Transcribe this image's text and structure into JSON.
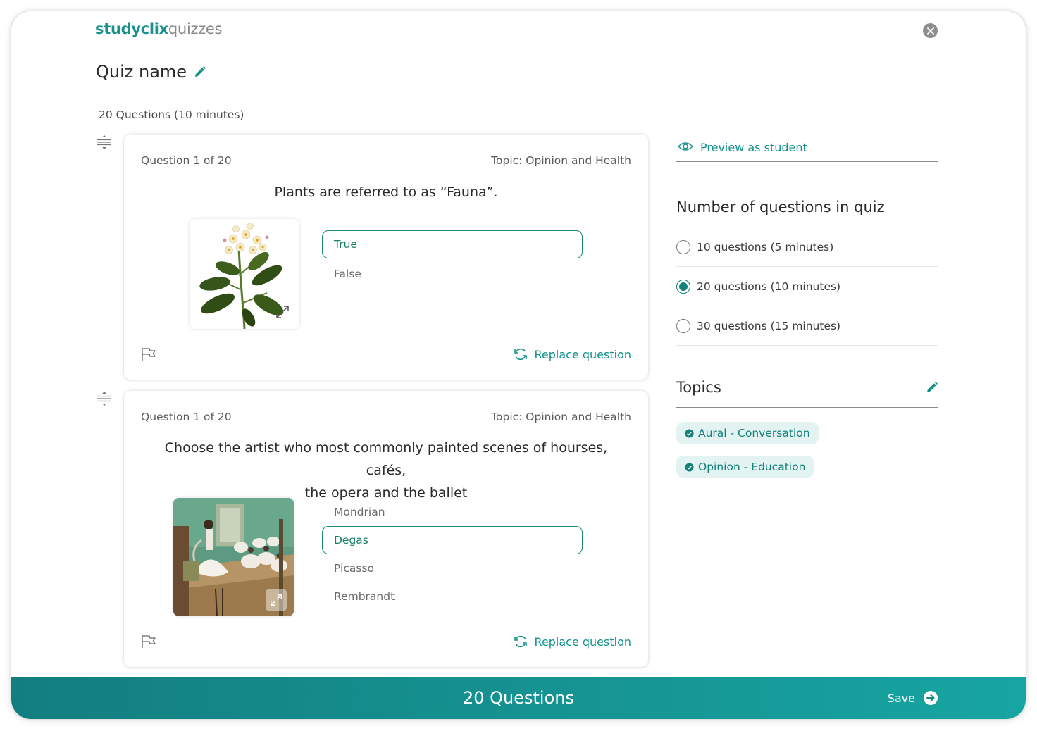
{
  "header": {
    "brand": "studyclix",
    "product": "quizzes",
    "title": "Quiz name"
  },
  "summary": "20 Questions (10 minutes)",
  "questions": [
    {
      "number_label": "Question 1 of 20",
      "topic_label": "Topic: Opinion and Health",
      "text": "Plants are referred to as “Fauna”.",
      "image": "flower-illustration",
      "answers": [
        {
          "label": "True",
          "correct": true
        },
        {
          "label": "False",
          "correct": false
        }
      ],
      "replace_label": "Replace question"
    },
    {
      "number_label": "Question 1 of 20",
      "topic_label": "Topic: Opinion and Health",
      "text_line1": "Choose the artist who most commonly painted scenes of hourses, cafés,",
      "text_line2": "the opera and the ballet",
      "image": "ballet-painting",
      "answers": [
        {
          "label": "Mondrian",
          "correct": false
        },
        {
          "label": "Degas",
          "correct": true
        },
        {
          "label": "Picasso",
          "correct": false
        },
        {
          "label": "Rembrandt",
          "correct": false
        }
      ],
      "replace_label": "Replace question"
    }
  ],
  "sidebar": {
    "preview_label": "Preview as student",
    "count_title": "Number of questions in quiz",
    "count_options": [
      {
        "label": "10 questions (5 minutes)",
        "selected": false
      },
      {
        "label": "20 questions (10 minutes)",
        "selected": true
      },
      {
        "label": "30 questions (15 minutes)",
        "selected": false
      }
    ],
    "topics_title": "Topics",
    "topics": [
      "Aural - Conversation",
      "Opinion - Education"
    ]
  },
  "footer": {
    "title": "20 Questions",
    "save_label": "Save"
  },
  "colors": {
    "accent": "#13918a",
    "correct_border": "#1a8a70",
    "chip_bg": "#e3f3f2",
    "footer_start": "#137e80",
    "footer_end": "#17a5a2"
  },
  "icons": [
    "close-icon",
    "pencil-icon",
    "drag-handle-icon",
    "expand-icon",
    "flag-icon",
    "refresh-icon",
    "eye-icon",
    "check-circle-icon",
    "arrow-right-circle-icon"
  ]
}
